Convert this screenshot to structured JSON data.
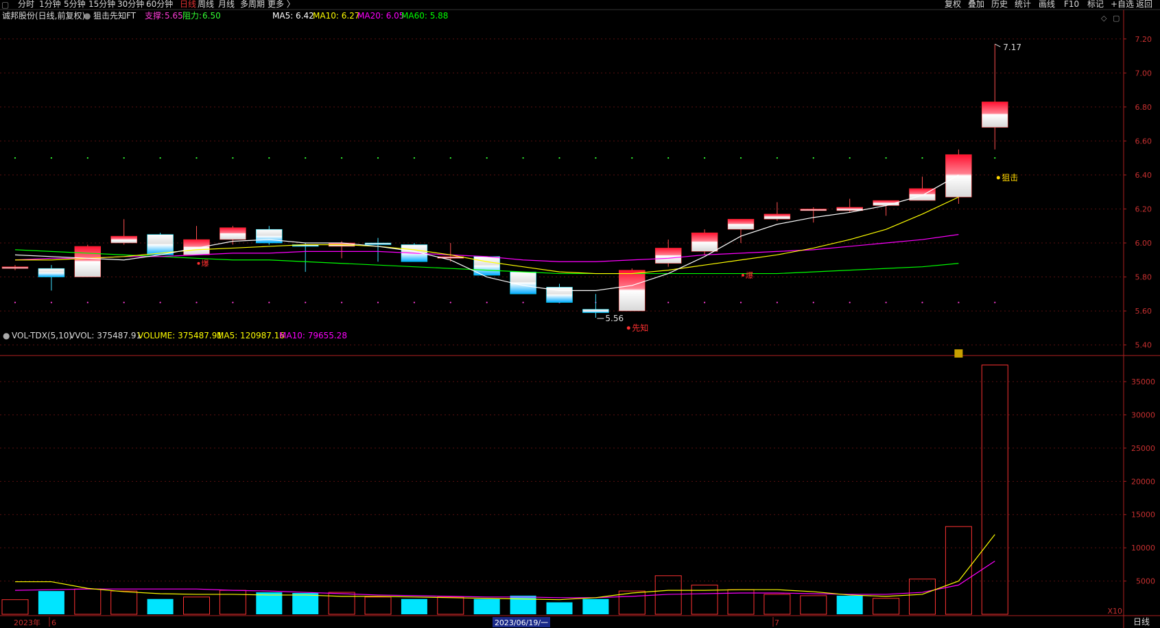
{
  "toolbar": {
    "left_tabs": [
      "分时",
      "1分钟",
      "5分钟",
      "15分钟",
      "30分钟",
      "60分钟",
      "日线",
      "周线",
      "月线",
      "多周期",
      "更多 〉"
    ],
    "active_tab": "日线",
    "right_tabs": [
      "复权",
      "叠加",
      "历史",
      "统计",
      "画线",
      "F10",
      "标记",
      "+自选",
      "返回"
    ]
  },
  "header": {
    "stock": "诚邦股份(日线,前复权)",
    "indicator": "狙击先知FT",
    "support_label": "支撑:",
    "support_value": "5.65",
    "resist_label": "阻力:",
    "resist_value": "6.50",
    "ma5": "MA5: 6.42",
    "ma10": "MA10: 6.27",
    "ma20": "MA20: 6.05",
    "ma60": "MA60: 5.88"
  },
  "vol_header": {
    "name": "VOL-TDX(5,10)",
    "vvol": "VVOL: 375487.91",
    "volume": "VOLUME: 375487.91",
    "ma5": "MA5: 120987.16",
    "ma10": "MA10: 79655.28"
  },
  "annotations": {
    "high": "7.17",
    "low": "5.56",
    "sniper": "狙击",
    "prophet": "先知",
    "burst": "爆",
    "vol_unit": "X10"
  },
  "xaxis": {
    "year": "2023年",
    "m6": "6",
    "date": "2023/06/19/一",
    "m7": "7",
    "period": "日线"
  },
  "colors": {
    "up": "#ff3232",
    "down": "#00e5ff",
    "ma5": "#ffffff",
    "ma10": "#ffff00",
    "ma20": "#ff00ff",
    "ma60": "#00ff00",
    "axis": "#b02020"
  },
  "chart_data": [
    {
      "type": "candlestick",
      "title": "诚邦股份(日线,前复权)",
      "ylim": [
        5.35,
        7.3
      ],
      "yticks": [
        5.4,
        5.6,
        5.8,
        6.0,
        6.2,
        6.4,
        6.6,
        6.8,
        7.0,
        7.2
      ],
      "support": 5.65,
      "resistance": 6.5,
      "candles": [
        {
          "o": 5.85,
          "h": 5.87,
          "l": 5.84,
          "c": 5.86
        },
        {
          "o": 5.85,
          "h": 5.87,
          "l": 5.72,
          "c": 5.8
        },
        {
          "o": 5.8,
          "h": 5.99,
          "l": 5.8,
          "c": 5.98
        },
        {
          "o": 6.0,
          "h": 6.14,
          "l": 5.99,
          "c": 6.04
        },
        {
          "o": 6.05,
          "h": 6.06,
          "l": 5.93,
          "c": 5.93
        },
        {
          "o": 5.93,
          "h": 6.1,
          "l": 5.93,
          "c": 6.02
        },
        {
          "o": 6.02,
          "h": 6.1,
          "l": 5.99,
          "c": 6.09
        },
        {
          "o": 6.08,
          "h": 6.1,
          "l": 5.99,
          "c": 6.0
        },
        {
          "o": 5.99,
          "h": 6.0,
          "l": 5.83,
          "c": 5.98
        },
        {
          "o": 5.98,
          "h": 6.01,
          "l": 5.91,
          "c": 6.0
        },
        {
          "o": 6.0,
          "h": 6.03,
          "l": 5.89,
          "c": 5.99
        },
        {
          "o": 5.99,
          "h": 6.0,
          "l": 5.89,
          "c": 5.89
        },
        {
          "o": 5.91,
          "h": 6.0,
          "l": 5.89,
          "c": 5.92
        },
        {
          "o": 5.92,
          "h": 5.92,
          "l": 5.81,
          "c": 5.81
        },
        {
          "o": 5.83,
          "h": 5.83,
          "l": 5.7,
          "c": 5.7
        },
        {
          "o": 5.74,
          "h": 5.76,
          "l": 5.65,
          "c": 5.65
        },
        {
          "o": 5.61,
          "h": 5.7,
          "l": 5.56,
          "c": 5.59
        },
        {
          "o": 5.6,
          "h": 5.85,
          "l": 5.6,
          "c": 5.84
        },
        {
          "o": 5.88,
          "h": 6.02,
          "l": 5.86,
          "c": 5.97
        },
        {
          "o": 5.95,
          "h": 6.08,
          "l": 5.93,
          "c": 6.06
        },
        {
          "o": 6.08,
          "h": 6.14,
          "l": 6.0,
          "c": 6.14
        },
        {
          "o": 6.14,
          "h": 6.24,
          "l": 6.13,
          "c": 6.17
        },
        {
          "o": 6.19,
          "h": 6.21,
          "l": 6.12,
          "c": 6.2
        },
        {
          "o": 6.19,
          "h": 6.26,
          "l": 6.18,
          "c": 6.21
        },
        {
          "o": 6.22,
          "h": 6.25,
          "l": 6.16,
          "c": 6.25
        },
        {
          "o": 6.25,
          "h": 6.39,
          "l": 6.25,
          "c": 6.32
        },
        {
          "o": 6.27,
          "h": 6.55,
          "l": 6.23,
          "c": 6.52
        },
        {
          "o": 6.68,
          "h": 7.17,
          "l": 6.55,
          "c": 6.83
        }
      ],
      "ma5": [
        5.93,
        5.92,
        5.91,
        5.9,
        5.93,
        5.97,
        6.01,
        6.02,
        6.0,
        6.0,
        5.98,
        5.95,
        5.9,
        5.8,
        5.75,
        5.72,
        5.72,
        5.75,
        5.82,
        5.92,
        6.04,
        6.11,
        6.15,
        6.18,
        6.22,
        6.28,
        6.4
      ],
      "ma10": [
        5.9,
        5.9,
        5.91,
        5.92,
        5.94,
        5.96,
        5.97,
        5.98,
        5.99,
        5.99,
        5.98,
        5.96,
        5.93,
        5.89,
        5.86,
        5.83,
        5.82,
        5.82,
        5.84,
        5.87,
        5.9,
        5.93,
        5.97,
        6.02,
        6.08,
        6.17,
        6.27
      ],
      "ma20": [
        5.9,
        5.91,
        5.91,
        5.92,
        5.92,
        5.93,
        5.94,
        5.94,
        5.95,
        5.95,
        5.95,
        5.94,
        5.93,
        5.92,
        5.9,
        5.89,
        5.89,
        5.9,
        5.91,
        5.93,
        5.94,
        5.95,
        5.96,
        5.98,
        6.0,
        6.02,
        6.05
      ],
      "ma60": [
        5.96,
        5.95,
        5.94,
        5.93,
        5.92,
        5.91,
        5.9,
        5.9,
        5.89,
        5.88,
        5.87,
        5.86,
        5.85,
        5.84,
        5.83,
        5.82,
        5.82,
        5.82,
        5.82,
        5.82,
        5.82,
        5.82,
        5.83,
        5.84,
        5.85,
        5.86,
        5.88
      ]
    },
    {
      "type": "bar",
      "title": "VOL-TDX(5,10)",
      "ylim": [
        0,
        38000
      ],
      "yticks": [
        5000,
        10000,
        15000,
        20000,
        25000,
        30000,
        35000
      ],
      "unit": "X10",
      "volumes": [
        2200,
        3500,
        3800,
        3500,
        2300,
        2600,
        3600,
        3300,
        3200,
        3300,
        2600,
        2300,
        2600,
        2300,
        2800,
        1800,
        2300,
        3500,
        5800,
        4400,
        3700,
        3000,
        2800,
        2800,
        2400,
        5300,
        13200,
        37500
      ],
      "up": [
        true,
        false,
        true,
        true,
        false,
        true,
        true,
        false,
        false,
        true,
        true,
        false,
        true,
        false,
        false,
        false,
        false,
        true,
        true,
        true,
        true,
        true,
        true,
        false,
        true,
        true,
        true,
        true
      ],
      "vol_ma5": [
        4900,
        4900,
        3900,
        3400,
        3100,
        3000,
        3000,
        2900,
        2900,
        2700,
        2700,
        2600,
        2500,
        2400,
        2300,
        2200,
        2500,
        3200,
        3600,
        3600,
        3700,
        3700,
        3400,
        2900,
        2700,
        3000,
        5000,
        12000
      ],
      "vol_ma10": [
        3600,
        3700,
        3800,
        3800,
        3800,
        3800,
        3600,
        3500,
        3300,
        3100,
        2900,
        2800,
        2700,
        2600,
        2600,
        2500,
        2500,
        2700,
        3000,
        3100,
        3200,
        3200,
        3100,
        3000,
        3000,
        3300,
        4400,
        8000
      ]
    }
  ]
}
